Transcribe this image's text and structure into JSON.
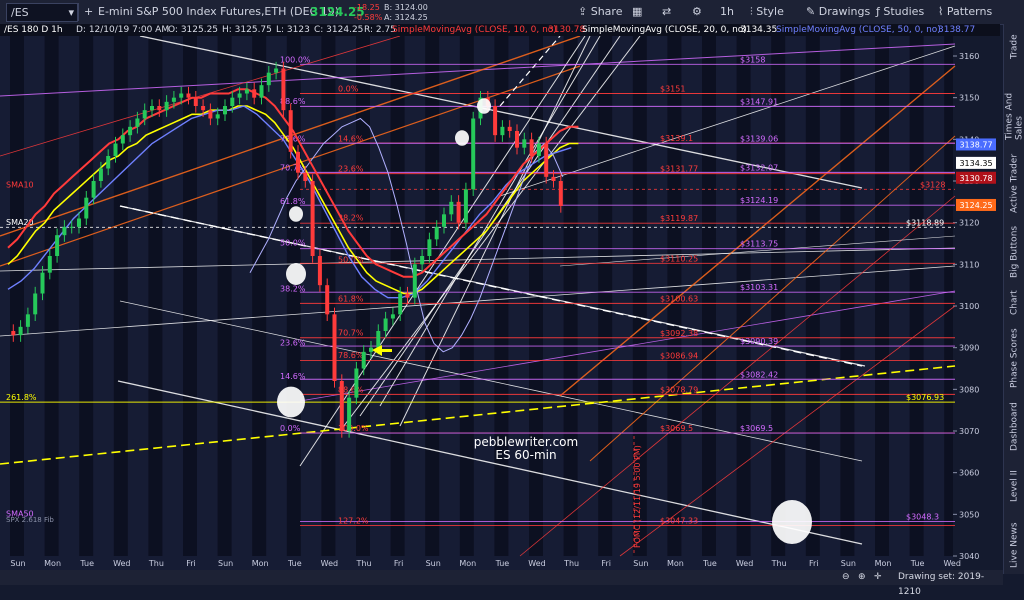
{
  "toolbar": {
    "symbol": "/ES",
    "instrument": "E-mini S&P 500 Index Futures,ETH (DEC 19)",
    "last_price": "3124.25",
    "change": "-18.25",
    "change_pct": "-0.58%",
    "bid": "B: 3124.00",
    "ask": "A: 3124.25",
    "share": "Share",
    "interval": "1h",
    "style": "Style",
    "drawings": "Drawings",
    "studies": "Studies",
    "patterns": "Patterns",
    "colors": {
      "up": "#26c95a",
      "down": "#ff3b3b"
    }
  },
  "status": {
    "label": "/ES 180 D 1h",
    "date": "D: 12/10/19 7:00 AM",
    "open": "O: 3125.25",
    "high": "H: 3125.75",
    "low": "L: 3123",
    "close": "C: 3124.25",
    "range": "R: 2.75",
    "sma10": "SimpleMovingAvg (CLOSE, 10, 0, no)",
    "sma10_val": "3130.78",
    "sma20": "SimpleMovingAvg (CLOSE, 20, 0, no)",
    "sma20_val": "3134.35",
    "sma50": "SimpleMovingAvg (CLOSE, 50, 0, no)",
    "sma50_val": "3138.77"
  },
  "sidebar": {
    "tabs": [
      "Trade",
      "Times And Sales",
      "Active Trader",
      "Big Buttons",
      "Chart",
      "Phase Scores",
      "Dashboard",
      "Level II",
      "Live News"
    ]
  },
  "bottom": {
    "drawing_set": "Drawing set: 2019-1210"
  },
  "chart_data": {
    "type": "candlestick",
    "ylim": [
      3040,
      3165
    ],
    "yticks": [
      "3040",
      "3050",
      "3060",
      "3070",
      "3080",
      "3090",
      "3100",
      "3110",
      "3120",
      "3130",
      "3140",
      "3150",
      "3160"
    ],
    "xticks": [
      "Sun",
      "Mon",
      "Tue",
      "Wed",
      "Thu",
      "Fri",
      "Sun",
      "Mon",
      "Tue",
      "Wed",
      "Thu",
      "Fri",
      "Sun",
      "Mon",
      "Tue",
      "Wed",
      "Thu",
      "Fri",
      "Sun",
      "Mon",
      "Tue",
      "Wed",
      "Thu",
      "Fri",
      "Sun",
      "Mon",
      "Tue",
      "Wed"
    ],
    "price_levels": [
      {
        "label": "$3158",
        "value": 3158,
        "color": "#d36bff"
      },
      {
        "label": "$3151",
        "value": 3151,
        "color": "#ff3b3b"
      },
      {
        "label": "$3147.91",
        "value": 3147.91,
        "color": "#d36bff"
      },
      {
        "label": "$3139.1",
        "value": 3139.1,
        "color": "#ff3b3b"
      },
      {
        "label": "$3139.06",
        "value": 3139.06,
        "color": "#d36bff"
      },
      {
        "label": "$3131.77",
        "value": 3131.77,
        "color": "#ff3b3b"
      },
      {
        "label": "$3132.07",
        "value": 3132.07,
        "color": "#d36bff"
      },
      {
        "label": "$3128",
        "value": 3128,
        "color": "#ff3b3b"
      },
      {
        "label": "$3124.19",
        "value": 3124.19,
        "color": "#d36bff"
      },
      {
        "label": "$3119.87",
        "value": 3119.87,
        "color": "#ff3b3b"
      },
      {
        "label": "$3118.89",
        "value": 3118.89,
        "color": "#ffffff"
      },
      {
        "label": "$3113.75",
        "value": 3113.75,
        "color": "#d36bff"
      },
      {
        "label": "$3110.25",
        "value": 3110.25,
        "color": "#ff3b3b"
      },
      {
        "label": "$3103.31",
        "value": 3103.31,
        "color": "#d36bff"
      },
      {
        "label": "$3100.63",
        "value": 3100.63,
        "color": "#ff3b3b"
      },
      {
        "label": "$3092.38",
        "value": 3092.38,
        "color": "#ff3b3b"
      },
      {
        "label": "$3090.39",
        "value": 3090.39,
        "color": "#d36bff"
      },
      {
        "label": "$3086.94",
        "value": 3086.94,
        "color": "#ff3b3b"
      },
      {
        "label": "$3082.42",
        "value": 3082.42,
        "color": "#d36bff"
      },
      {
        "label": "$3078.79",
        "value": 3078.79,
        "color": "#ff3b3b"
      },
      {
        "label": "$3076.93",
        "value": 3076.93,
        "color": "#ffff00"
      },
      {
        "label": "$3069.5",
        "value": 3069.5,
        "color": "#ff3b3b"
      },
      {
        "label": "$3069.5",
        "value": 3069.5,
        "color": "#d36bff"
      },
      {
        "label": "$3048.3",
        "value": 3048.3,
        "color": "#d36bff"
      },
      {
        "label": "$3047.33",
        "value": 3047.33,
        "color": "#ff3b3b"
      }
    ],
    "fib_left": [
      {
        "label": "100.0%",
        "value": 3158
      },
      {
        "label": "88.6%",
        "value": 3148
      },
      {
        "label": "78.6%",
        "value": 3139
      },
      {
        "label": "70.7%",
        "value": 3132
      },
      {
        "label": "61.8%",
        "value": 3124
      },
      {
        "label": "50.0%",
        "value": 3114
      },
      {
        "label": "38.2%",
        "value": 3103
      },
      {
        "label": "23.6%",
        "value": 3090
      },
      {
        "label": "14.6%",
        "value": 3082
      },
      {
        "label": "0.0%",
        "value": 3069.5
      }
    ],
    "fib_mid": [
      {
        "label": "0.0%",
        "value": 3151
      },
      {
        "label": "14.6%",
        "value": 3139
      },
      {
        "label": "23.6%",
        "value": 3131.8
      },
      {
        "label": "38.2%",
        "value": 3120
      },
      {
        "label": "50.0%",
        "value": 3110
      },
      {
        "label": "61.8%",
        "value": 3100.6
      },
      {
        "label": "70.7%",
        "value": 3092.4
      },
      {
        "label": "78.6%",
        "value": 3087
      },
      {
        "label": "88.6%",
        "value": 3078.8
      },
      {
        "label": "100.0%",
        "value": 3069.5
      },
      {
        "label": "127.2%",
        "value": 3047.3
      }
    ],
    "left_labels": [
      {
        "label": "SMA10",
        "value": 3128
      },
      {
        "label": "SMA20",
        "value": 3119
      },
      {
        "label": "261.8%",
        "value": 3077
      },
      {
        "label": "SMA50",
        "value": 3049
      }
    ],
    "axis_tags": [
      {
        "label": "3138.77",
        "value": 3138.77,
        "bg": "#4a6cff"
      },
      {
        "label": "3134.35",
        "value": 3134.35,
        "bg": "#ffffff"
      },
      {
        "label": "3130.78",
        "value": 3130.78,
        "bg": "#b0111a"
      },
      {
        "label": "3124.25",
        "value": 3124.25,
        "bg": "#ff6a1a"
      }
    ],
    "watermark": "pebblewriter.com",
    "watermark2": "ES 60-min",
    "event_label": "FOMC (12/11/19 5:00 PM)",
    "spx_label": "SPX 2.618 Fib",
    "series": [
      {
        "name": "price",
        "values": [
          3094,
          3093,
          3095,
          3098,
          3103,
          3108,
          3112,
          3117,
          3119,
          3119,
          3121,
          3126,
          3130,
          3133,
          3136,
          3139,
          3141,
          3143,
          3145,
          3147,
          3148,
          3147,
          3149,
          3150,
          3151,
          3150,
          3148,
          3147,
          3145,
          3146,
          3148,
          3150,
          3151,
          3152,
          3150,
          3153,
          3156,
          3157,
          3147,
          3137,
          3132,
          3130,
          3112,
          3105,
          3098,
          3082,
          3070,
          3078,
          3085,
          3089,
          3090,
          3094,
          3097,
          3098,
          3103,
          3102,
          3110,
          3112,
          3116,
          3119,
          3122,
          3125,
          3120,
          3128,
          3145,
          3150,
          3148,
          3141,
          3143,
          3142,
          3138,
          3140,
          3136,
          3139,
          3131,
          3130,
          3124
        ]
      },
      {
        "name": "SMA50",
        "values": [
          3110,
          3112,
          3115,
          3118,
          3120,
          3123,
          3125,
          3127,
          3129,
          3131,
          3133,
          3135,
          3136,
          3138,
          3139,
          3141,
          3142,
          3143,
          3144,
          3145,
          3146,
          3146,
          3147,
          3147,
          3147,
          3148,
          3148,
          3147,
          3146,
          3144,
          3141,
          3138,
          3134,
          3130,
          3126,
          3122,
          3118,
          3114,
          3111,
          3108,
          3106,
          3105,
          3104,
          3103,
          3103,
          3104,
          3106,
          3108,
          3110,
          3112,
          3114,
          3116,
          3118,
          3121,
          3124,
          3127,
          3130,
          3132,
          3134,
          3136,
          3138,
          3139,
          3139
        ]
      },
      {
        "name": "SMA20",
        "values": [
          3104,
          3106,
          3109,
          3113,
          3117,
          3121,
          3124,
          3127,
          3130,
          3133,
          3136,
          3139,
          3141,
          3143,
          3145,
          3146,
          3147,
          3147,
          3148,
          3146,
          3143,
          3140,
          3135,
          3130,
          3124,
          3118,
          3112,
          3107,
          3104,
          3102,
          3102,
          3103,
          3106,
          3110,
          3114,
          3118,
          3122,
          3125,
          3129,
          3132,
          3134,
          3136,
          3137,
          3138
        ]
      },
      {
        "name": "SMA10",
        "values": [
          3108,
          3112,
          3116,
          3121,
          3126,
          3130,
          3133,
          3136,
          3139,
          3141,
          3143,
          3144,
          3145,
          3143,
          3138,
          3132,
          3124,
          3115,
          3105,
          3096,
          3091,
          3089,
          3090,
          3093,
          3097,
          3102,
          3108,
          3114,
          3120,
          3126,
          3132,
          3137,
          3139,
          3136,
          3131
        ]
      }
    ]
  }
}
